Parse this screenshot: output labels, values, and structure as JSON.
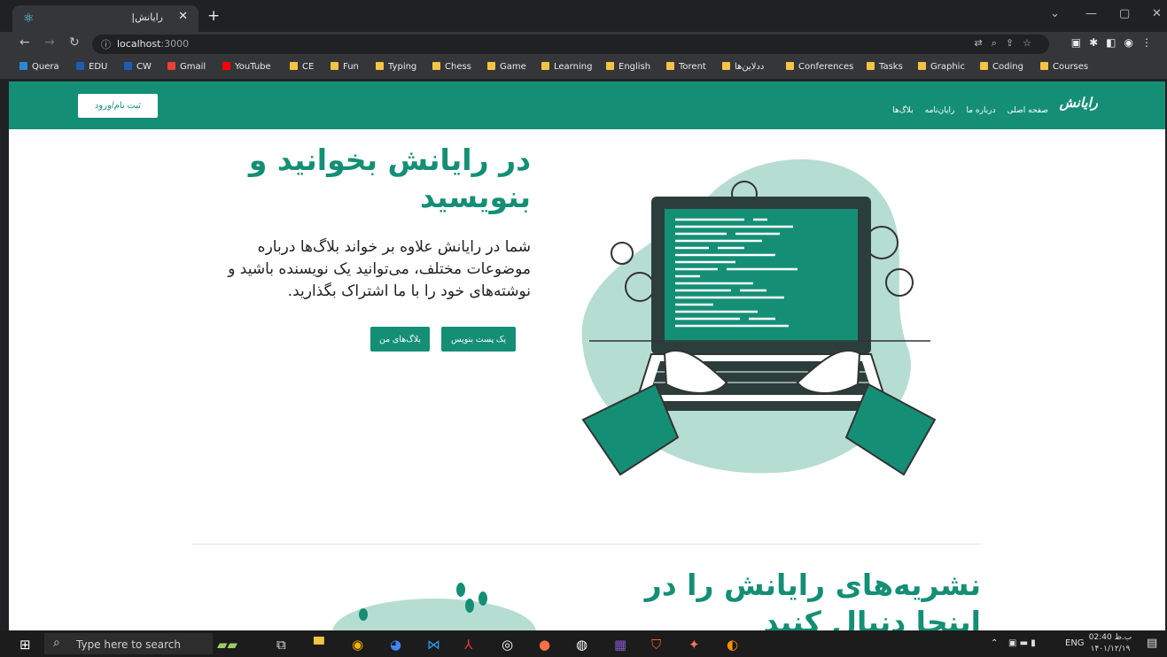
{
  "browser": {
    "tab_title": "رایانش|",
    "url_host": "localhost",
    "url_port": ":3000"
  },
  "bookmarks": [
    {
      "label": "Quera",
      "color": "#2b87d1"
    },
    {
      "label": "EDU",
      "color": "#1a5fb4"
    },
    {
      "label": "CW",
      "color": "#1a5fb4"
    },
    {
      "label": "Gmail",
      "color": "#ea4335"
    },
    {
      "label": "YouTube",
      "color": "#ff0000"
    },
    {
      "label": "CE",
      "color": "#f6c344"
    },
    {
      "label": "Fun",
      "color": "#f6c344"
    },
    {
      "label": "Typing",
      "color": "#f6c344"
    },
    {
      "label": "Chess",
      "color": "#f6c344"
    },
    {
      "label": "Game",
      "color": "#f6c344"
    },
    {
      "label": "Learning",
      "color": "#f6c344"
    },
    {
      "label": "English",
      "color": "#f6c344"
    },
    {
      "label": "Torent",
      "color": "#f6c344"
    },
    {
      "label": "ددلاین‌ها",
      "color": "#f6c344"
    },
    {
      "label": "Conferences",
      "color": "#f6c344"
    },
    {
      "label": "Tasks",
      "color": "#f6c344"
    },
    {
      "label": "Graphic",
      "color": "#f6c344"
    },
    {
      "label": "Coding",
      "color": "#f6c344"
    },
    {
      "label": "Courses",
      "color": "#f6c344"
    }
  ],
  "site": {
    "logo": "رایانش",
    "login_label": "ثبت نام/ورود",
    "nav": [
      "صفحه اصلی",
      "درباره ما",
      "رایان‌نامه",
      "بلاگ‌ها"
    ],
    "hero_title": "در رایانش بخوانید و بنویسید",
    "hero_desc": "شما در رایانش علاوه بر خواند بلاگ‌ها درباره موضوعات مختلف، می‌توانید یک نویسنده باشید و نوشته‌های خود را با ما اشتراک بگذارید.",
    "write_post_label": "یک پست بنویس",
    "my_blogs_label": "بلاگ‌های من",
    "newsletter_title": "نشریه‌های رایانش را در اینجا دنبال کنید",
    "brand_color": "#148f76",
    "light_color": "#b6ddd1"
  },
  "taskbar": {
    "search_placeholder": "Type here to search",
    "lang": "ENG",
    "time": "02:40 ب.ظ",
    "date": "۱۴۰۱/۱۲/۱۹"
  }
}
